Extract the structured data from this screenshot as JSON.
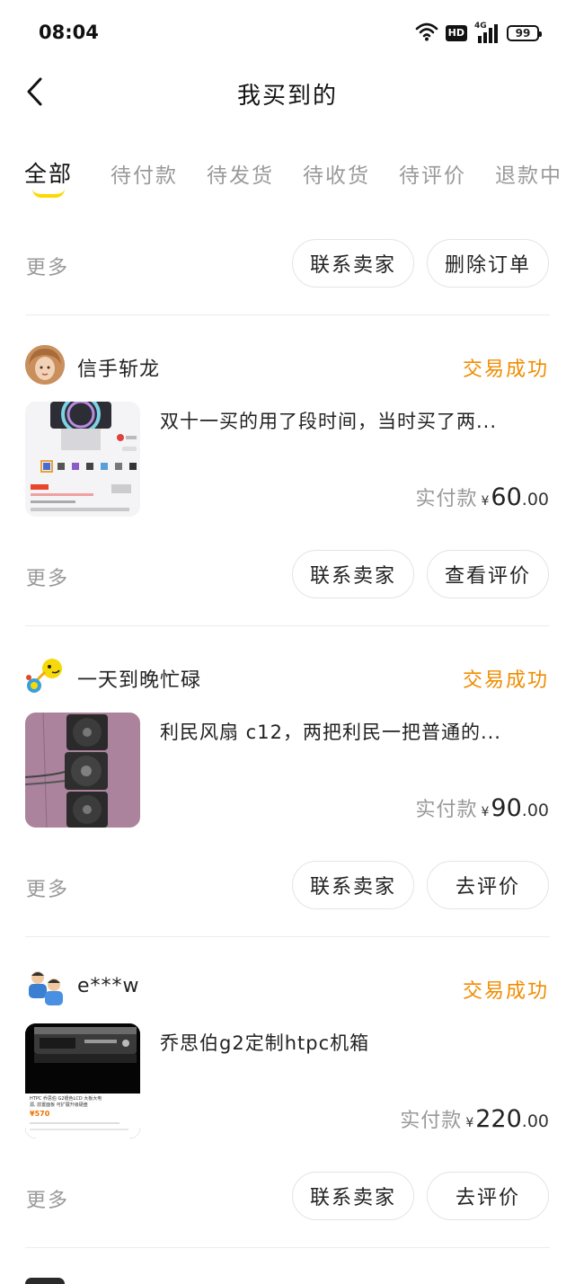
{
  "status_bar": {
    "time": "08:04",
    "network": "4G",
    "hd_label": "HD",
    "battery": "99",
    "icons": [
      "wifi-icon",
      "hd-icon",
      "signal-icon",
      "battery-icon"
    ]
  },
  "header": {
    "title": "我买到的",
    "back_icon": "chevron-left-icon"
  },
  "tabs": [
    "全部",
    "待付款",
    "待发货",
    "待收货",
    "待评价",
    "退款中"
  ],
  "active_tab": 0,
  "accent_color": "#ffd800",
  "status_color": "#f08c00",
  "top_actions": {
    "more": "更多",
    "contact_seller": "联系卖家",
    "delete_order": "删除订单"
  },
  "orders": [
    {
      "seller": "信手斩龙",
      "status": "交易成功",
      "title": "双十一买的用了段时间，当时买了两...",
      "price_label": "实付款",
      "currency": "¥",
      "price_int": "60",
      "price_dec": ".00",
      "more": "更多",
      "action_1": "联系卖家",
      "action_2": "查看评价"
    },
    {
      "seller": "一天到晚忙碌",
      "status": "交易成功",
      "title": "利民风扇 c12，两把利民一把普通的...",
      "price_label": "实付款",
      "currency": "¥",
      "price_int": "90",
      "price_dec": ".00",
      "more": "更多",
      "action_1": "联系卖家",
      "action_2": "去评价"
    },
    {
      "seller": "e***w",
      "status": "交易成功",
      "title": "乔思伯g2定制htpc机箱",
      "price_label": "实付款",
      "currency": "¥",
      "price_int": "220",
      "price_dec": ".00",
      "more": "更多",
      "action_1": "联系卖家",
      "action_2": "去评价",
      "thumb_text": {
        "line1": "HTPC 乔思伯 G2银色LCD 大板大电",
        "line2": "源, 前置面板 可扩展升级硬盘",
        "price": "¥570"
      }
    }
  ]
}
